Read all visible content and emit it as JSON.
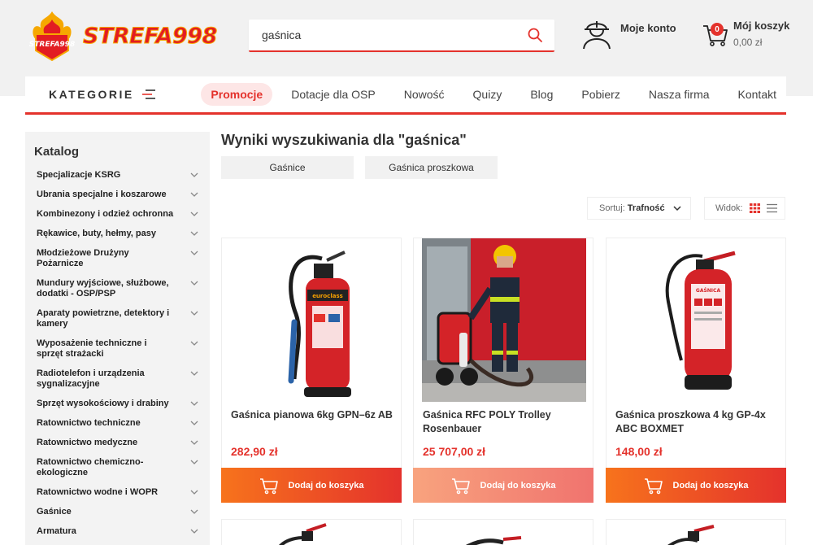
{
  "header": {
    "logo_text": "STREFA998",
    "search": {
      "value": "gaśnica",
      "placeholder": ""
    },
    "account_label": "Moje konto",
    "cart": {
      "label": "Mój koszyk",
      "amount": "0,00 zł",
      "count": "0"
    }
  },
  "nav": {
    "categories_label": "KATEGORIE",
    "items": [
      "Promocje",
      "Dotacje dla OSP",
      "Nowość",
      "Quizy",
      "Blog",
      "Pobierz",
      "Nasza firma",
      "Kontakt"
    ]
  },
  "sidebar": {
    "title": "Katalog",
    "categories": [
      "Specjalizacje KSRG",
      "Ubrania specjalne i koszarowe",
      "Kombinezony i odzież ochronna",
      "Rękawice, buty, hełmy, pasy",
      "Młodzieżowe Drużyny Pożarnicze",
      "Mundury wyjściowe, służbowe, dodatki - OSP/PSP",
      "Aparaty powietrzne, detektory i kamery",
      "Wyposażenie techniczne i sprzęt strażacki",
      "Radiotelefon i urządzenia sygnalizacyjne",
      "Sprzęt wysokościowy i drabiny",
      "Ratownictwo techniczne",
      "Ratownictwo medyczne",
      "Ratownictwo chemiczno-ekologiczne",
      "Ratownictwo wodne i WOPR",
      "Gaśnice",
      "Armatura"
    ]
  },
  "results": {
    "title": "Wyniki wyszukiwania dla \"gaśnica\"",
    "suggestions": [
      "Gaśnice",
      "Gaśnica proszkowa"
    ],
    "sort_label": "Sortuj:",
    "sort_value": "Trafność",
    "view_label": "Widok:"
  },
  "products": [
    {
      "name": "Gaśnica pianowa 6kg GPN–6z AB",
      "price": "282,90 zł",
      "button": "Dodaj do koszyka",
      "image_label": "euroclass"
    },
    {
      "name": "Gaśnica RFC POLY Trolley Rosenbauer",
      "price": "25 707,00 zł",
      "button": "Dodaj do koszyka"
    },
    {
      "name": "Gaśnica proszkowa 4 kg GP-4x ABC BOXMET",
      "price": "148,00 zł",
      "button": "Dodaj do koszyka",
      "image_label": "GAŚNICA"
    }
  ],
  "colors": {
    "accent": "#e4322c",
    "orange": "#f7731c",
    "promo_bg": "#fde6e6"
  }
}
